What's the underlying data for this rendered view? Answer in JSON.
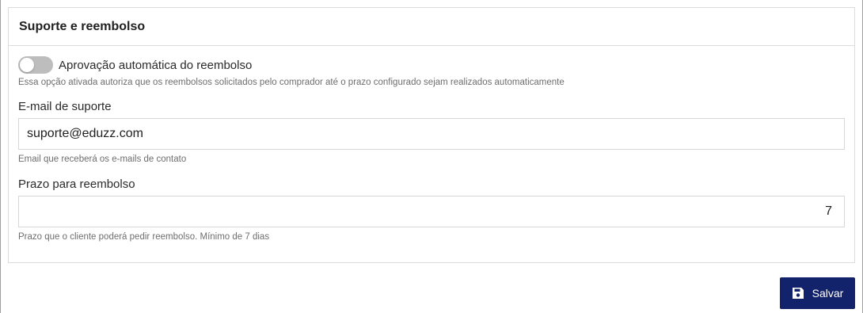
{
  "card": {
    "title": "Suporte e reembolso"
  },
  "auto_refund": {
    "label": "Aprovação automática do reembolso",
    "help": "Essa opção ativada autoriza que os reembolsos solicitados pelo comprador até o prazo configurado sejam realizados automaticamente",
    "enabled": false
  },
  "support_email": {
    "label": "E-mail de suporte",
    "value": "suporte@eduzz.com",
    "help": "Email que receberá os e-mails de contato"
  },
  "refund_period": {
    "label": "Prazo para reembolso",
    "value": "7",
    "help": "Prazo que o cliente poderá pedir reembolso. Mínimo de 7 dias"
  },
  "actions": {
    "save_label": "Salvar",
    "save_icon": "save-icon",
    "primary_color": "#12236b"
  }
}
